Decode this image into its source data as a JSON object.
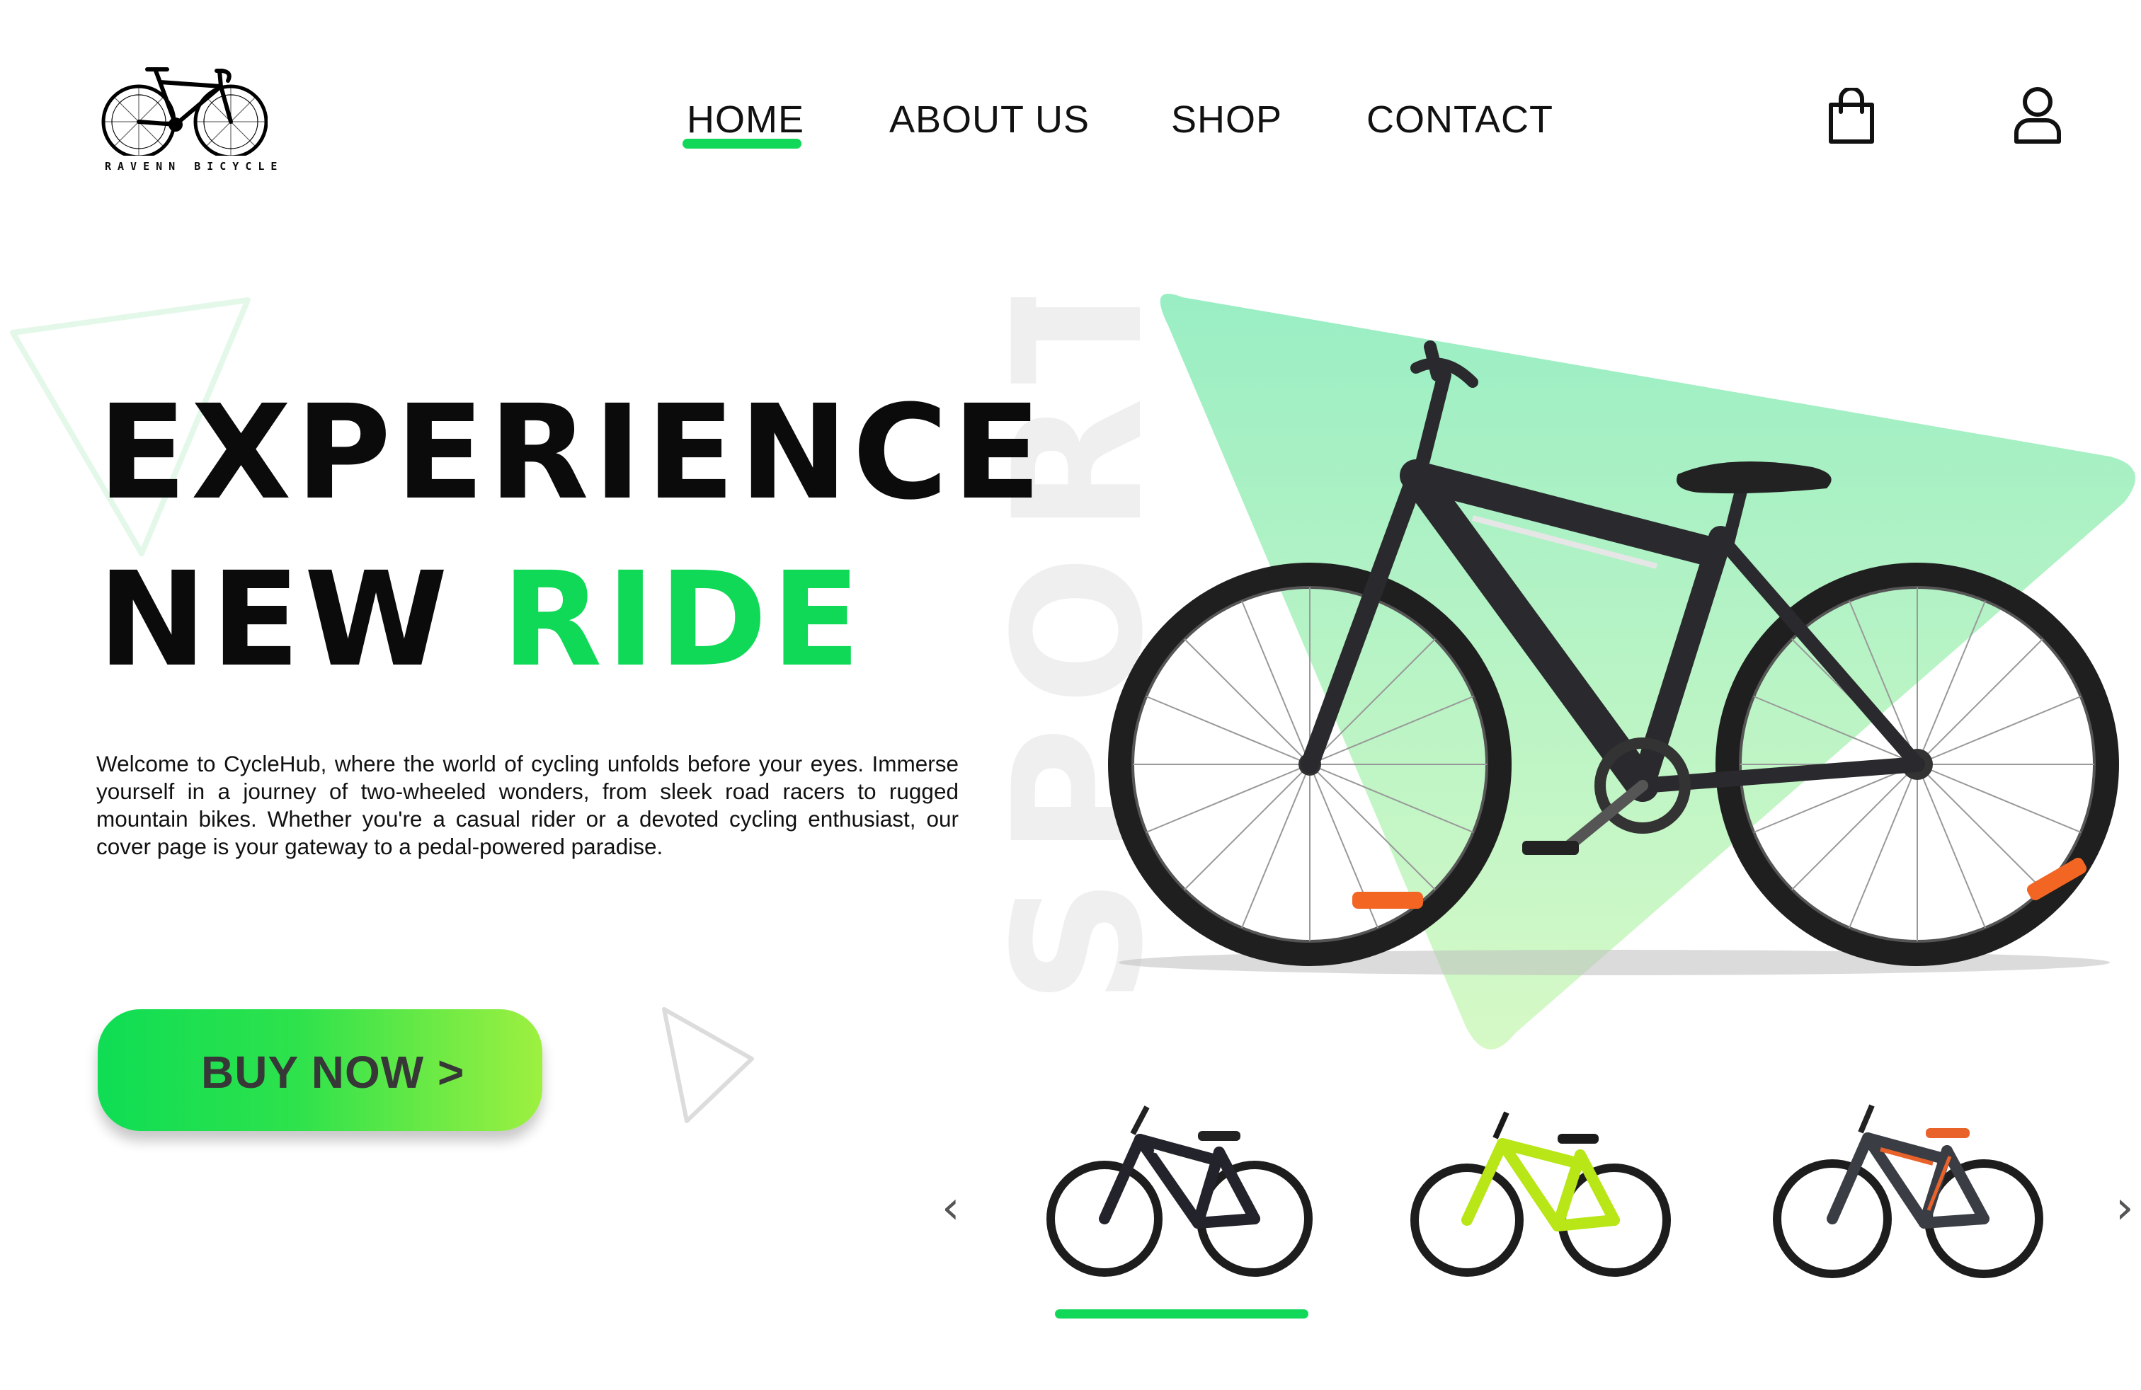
{
  "brand": {
    "logo_text": "RAVENN BICYCLE",
    "accent_color": "#0fd957"
  },
  "nav": {
    "items": [
      {
        "label": "HOME",
        "active": true
      },
      {
        "label": "ABOUT US",
        "active": false
      },
      {
        "label": "SHOP",
        "active": false
      },
      {
        "label": "CONTACT",
        "active": false
      }
    ],
    "icons": [
      "shopping-bag-icon",
      "user-icon"
    ]
  },
  "hero": {
    "headline_line1": "EXPERIENCE",
    "headline_line2_part1": "NEW ",
    "headline_line2_part2": "RIDE",
    "background_word": "SPORT",
    "description": "Welcome to CycleHub, where the world of cycling unfolds before your eyes. Immerse yourself in a journey of two-wheeled wonders, from sleek road racers to rugged mountain bikes. Whether you're a casual rider or a devoted cycling enthusiast, our cover page is your gateway to a pedal-powered paradise.",
    "cta_label": "BUY NOW >"
  },
  "carousel": {
    "prev_symbol": "‹",
    "next_symbol": "›",
    "thumbnails": [
      {
        "name": "black-white-bike",
        "frame_color": "#23232b",
        "accent_color": "#ffffff",
        "active": true
      },
      {
        "name": "neon-yellow-bike",
        "frame_color": "#b8e617",
        "accent_color": "#1a1a1a",
        "active": false
      },
      {
        "name": "orange-grey-bike",
        "frame_color": "#3a3d44",
        "accent_color": "#e8622a",
        "active": false
      }
    ]
  }
}
